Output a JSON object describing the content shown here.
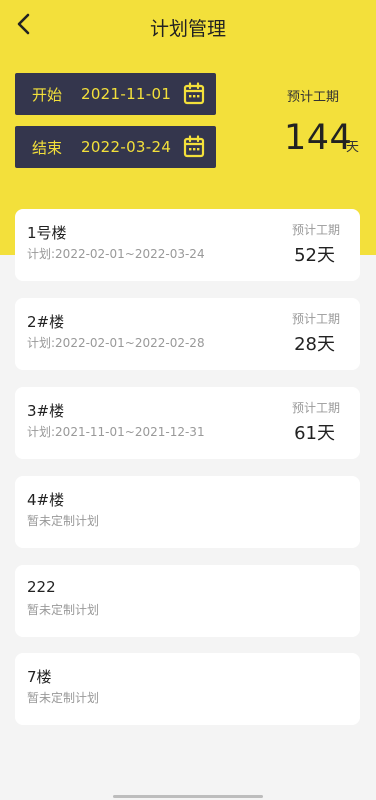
{
  "header": {
    "title": "计划管理",
    "back_icon": "chevron-left-icon"
  },
  "range": {
    "start_label": "开始",
    "start_value": "2021-11-01",
    "end_label": "结束",
    "end_value": "2022-03-24",
    "calendar_icon": "calendar-icon"
  },
  "summary": {
    "label": "预计工期",
    "days": "144",
    "unit": "天"
  },
  "cards": [
    {
      "name": "1号楼",
      "plan": "计划:2022-02-01~2022-03-24",
      "est_label": "预计工期",
      "est_days": "52天"
    },
    {
      "name": "2#楼",
      "plan": "计划:2022-02-01~2022-02-28",
      "est_label": "预计工期",
      "est_days": "28天"
    },
    {
      "name": "3#楼",
      "plan": "计划:2021-11-01~2021-12-31",
      "est_label": "预计工期",
      "est_days": "61天"
    },
    {
      "name": "4#楼",
      "plan": "暂未定制计划"
    },
    {
      "name": "222",
      "plan": "暂未定制计划"
    },
    {
      "name": "7楼",
      "plan": "暂未定制计划"
    }
  ],
  "colors": {
    "accent": "#f3e03b",
    "dark": "#34364d",
    "background": "#f4f4f4"
  }
}
